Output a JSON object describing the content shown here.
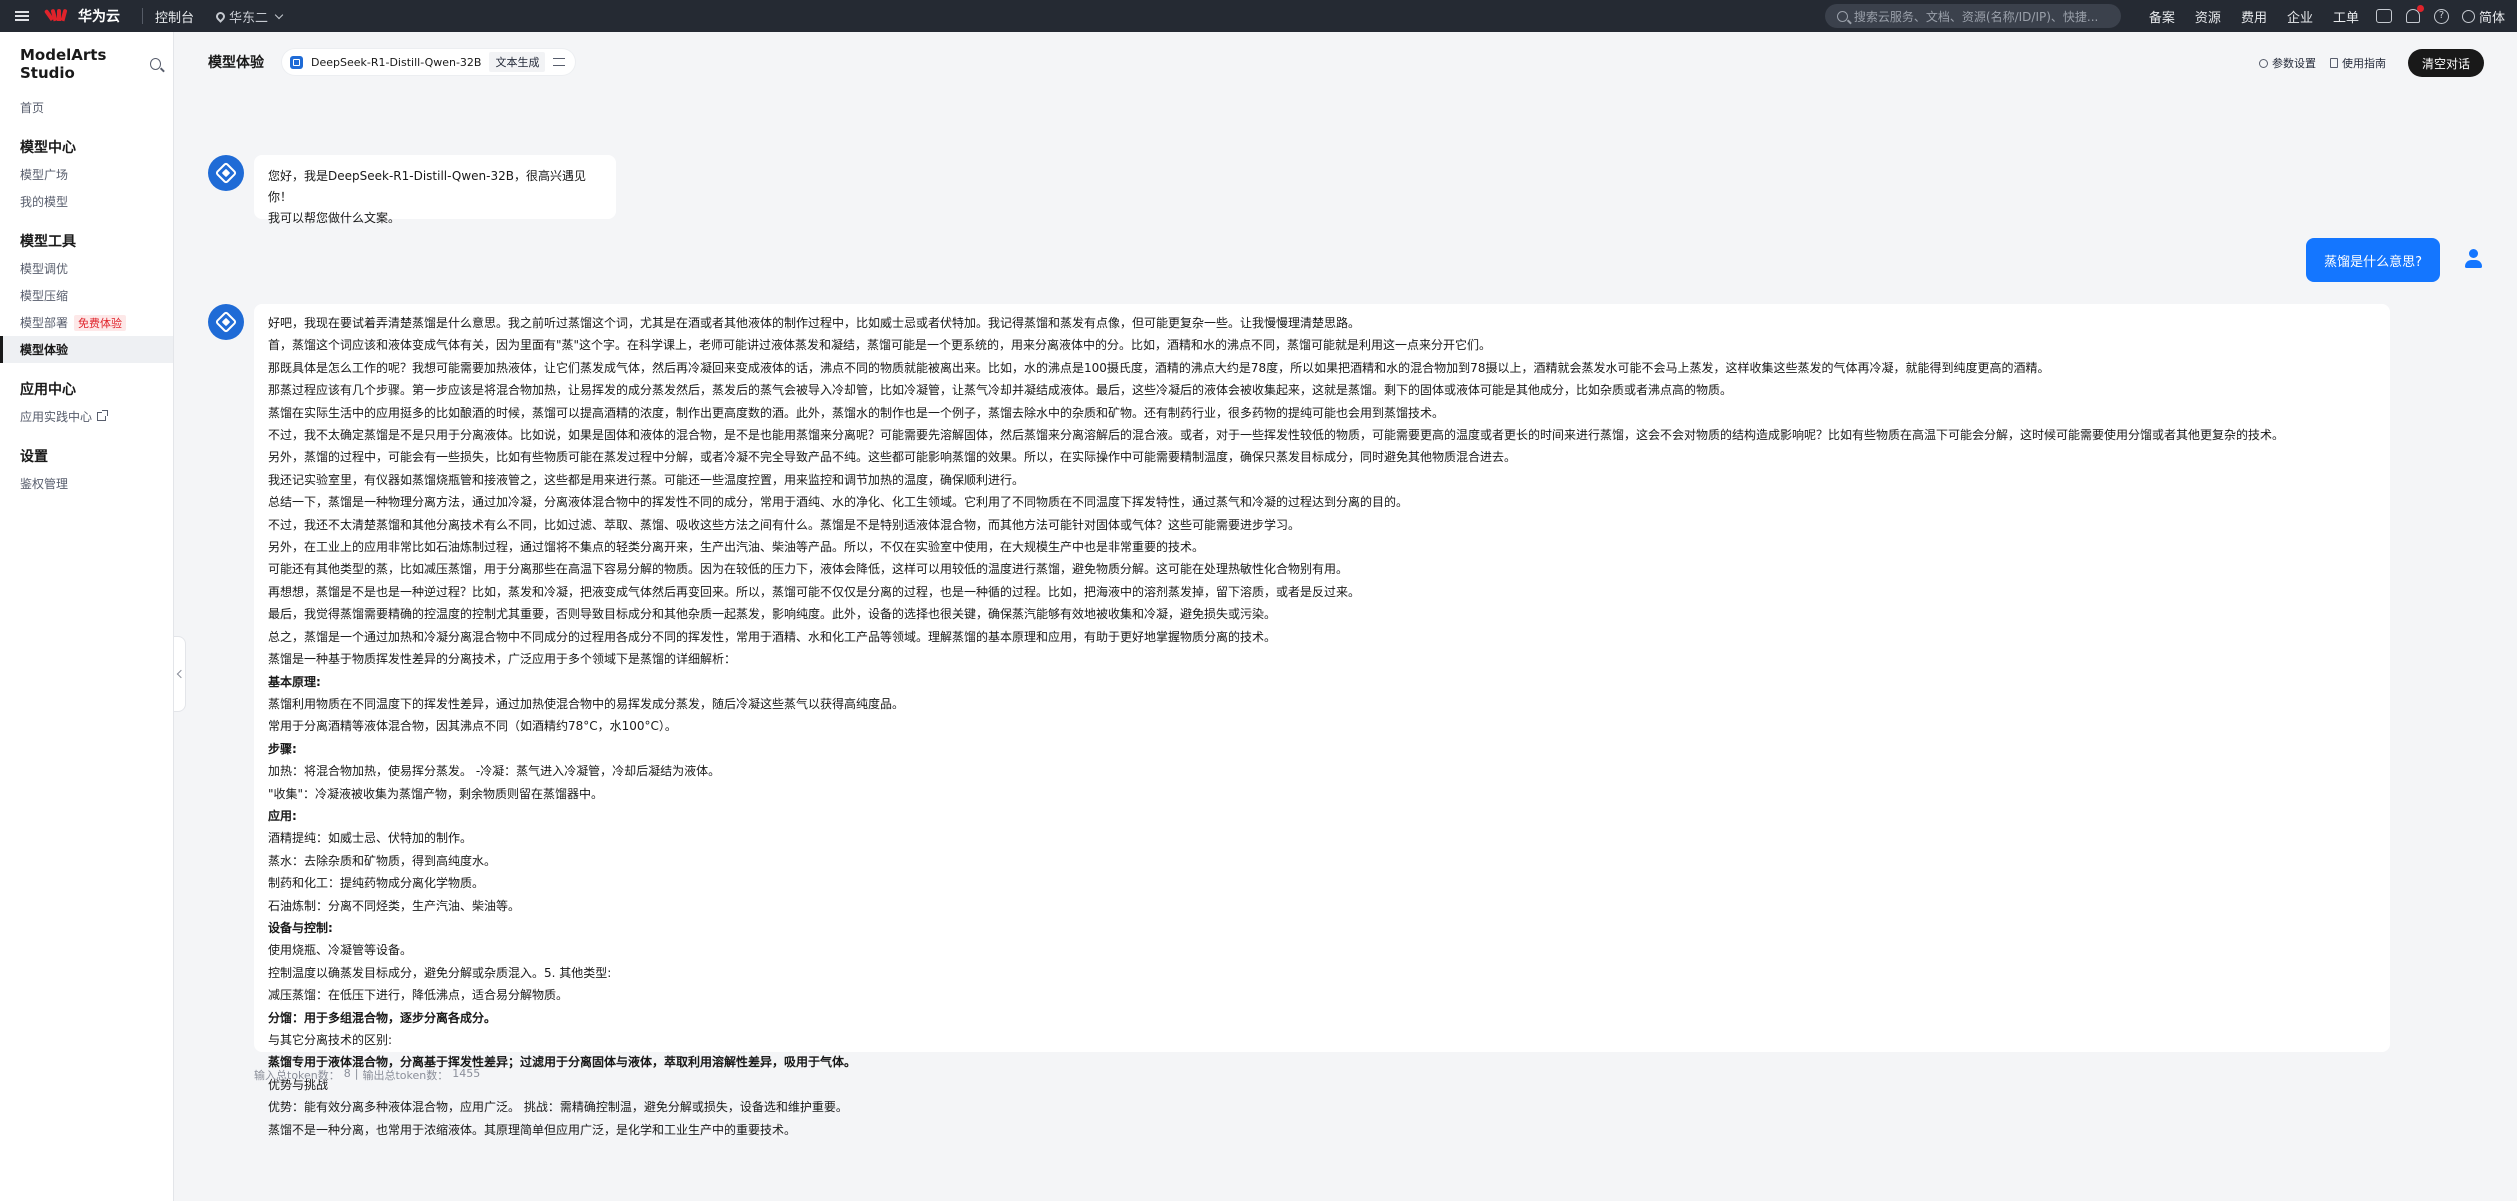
{
  "topbar": {
    "brand": "华为云",
    "console": "控制台",
    "region": "华东二",
    "search_placeholder": "搜索云服务、文档、资源(名称/ID/IP)、快捷...",
    "nav": [
      "备案",
      "资源",
      "费用",
      "企业",
      "工单"
    ],
    "language": "简体"
  },
  "sidebar": {
    "title": "ModelArts Studio",
    "home": "首页",
    "groups": [
      {
        "title": "模型中心",
        "items": [
          "模型广场",
          "我的模型"
        ]
      },
      {
        "title": "模型工具",
        "items": [
          "模型调优",
          "模型压缩",
          "模型部署",
          "模型体验"
        ]
      },
      {
        "title": "应用中心",
        "items": [
          "应用实践中心"
        ]
      },
      {
        "title": "设置",
        "items": [
          "鉴权管理"
        ]
      }
    ],
    "free_badge": "免费体验"
  },
  "header": {
    "title": "模型体验",
    "model": "DeepSeek-R1-Distill-Qwen-32B",
    "task": "文本生成",
    "param_settings": "参数设置",
    "guide": "使用指南",
    "clear": "清空对话"
  },
  "chat": {
    "greeting": [
      "您好，我是DeepSeek-R1-Distill-Qwen-32B，很高兴遇见你！",
      "我可以帮您做什么文案。"
    ],
    "user_message": "蒸馏是什么意思?",
    "answer_lines": [
      "好吧，我现在要试着弄清楚蒸馏是什么意思。我之前听过蒸馏这个词，尤其是在酒或者其他液体的制作过程中，比如威士忌或者伏特加。我记得蒸馏和蒸发有点像，但可能更复杂一些。让我慢慢理清楚思路。",
      "首，蒸馏这个词应该和液体变成气体有关，因为里面有\"蒸\"这个字。在科学课上，老师可能讲过液体蒸发和凝结，蒸馏可能是一个更系统的，用来分离液体中的分。比如，酒精和水的沸点不同，蒸馏可能就是利用这一点来分开它们。",
      "那既具体是怎么工作的呢？我想可能需要加热液体，让它们蒸发成气体，然后再冷凝回来变成液体的话，沸点不同的物质就能被离出来。比如，水的沸点是100摄氏度，酒精的沸点大约是78度，所以如果把酒精和水的混合物加到78摄以上，酒精就会蒸发水可能不会马上蒸发，这样收集这些蒸发的气体再冷凝，就能得到纯度更高的酒精。",
      "那蒸过程应该有几个步骤。第一步应该是将混合物加热，让易挥发的成分蒸发然后，蒸发后的蒸气会被导入冷却管，比如冷凝管，让蒸气冷却并凝结成液体。最后，这些冷凝后的液体会被收集起来，这就是蒸馏。剩下的固体或液体可能是其他成分，比如杂质或者沸点高的物质。",
      "蒸馏在实际生活中的应用挺多的比如酿酒的时候，蒸馏可以提高酒精的浓度，制作出更高度数的酒。此外，蒸馏水的制作也是一个例子，蒸馏去除水中的杂质和矿物。还有制药行业，很多药物的提纯可能也会用到蒸馏技术。",
      "不过，我不太确定蒸馏是不是只用于分离液体。比如说，如果是固体和液体的混合物，是不是也能用蒸馏来分离呢？可能需要先溶解固体，然后蒸馏来分离溶解后的混合液。或者，对于一些挥发性较低的物质，可能需要更高的温度或者更长的时间来进行蒸馏，这会不会对物质的结构造成影响呢？比如有些物质在高温下可能会分解，这时候可能需要使用分馏或者其他更复杂的技术。",
      "另外，蒸馏的过程中，可能会有一些损失，比如有些物质可能在蒸发过程中分解，或者冷凝不完全导致产品不纯。这些都可能影响蒸馏的效果。所以，在实际操作中可能需要精制温度，确保只蒸发目标成分，同时避免其他物质混合进去。",
      "我还记实验室里，有仪器如蒸馏烧瓶管和接液管之，这些都是用来进行蒸。可能还一些温度控置，用来监控和调节加热的温度，确保顺利进行。",
      "总结一下，蒸馏是一种物理分离方法，通过加冷凝，分离液体混合物中的挥发性不同的成分，常用于酒纯、水的净化、化工生领域。它利用了不同物质在不同温度下挥发特性，通过蒸气和冷凝的过程达到分离的目的。",
      "不过，我还不太清楚蒸馏和其他分离技术有么不同，比如过滤、萃取、蒸馏、吸收这些方法之间有什么。蒸馏是不是特别适液体混合物，而其他方法可能针对固体或气体？这些可能需要进步学习。",
      "另外，在工业上的应用非常比如石油炼制过程，通过馏将不集点的轻类分离开来，生产出汽油、柴油等产品。所以，不仅在实验室中使用，在大规模生产中也是非常重要的技术。",
      "可能还有其他类型的蒸，比如减压蒸馏，用于分离那些在高温下容易分解的物质。因为在较低的压力下，液体会降低，这样可以用较低的温度进行蒸馏，避免物质分解。这可能在处理热敏性化合物别有用。",
      "再想想，蒸馏是不是也是一种逆过程？比如，蒸发和冷凝，把液变成气体然后再变回来。所以，蒸馏可能不仅仅是分离的过程，也是一种循的过程。比如，把海液中的溶剂蒸发掉，留下溶质，或者是反过来。",
      "最后，我觉得蒸馏需要精确的控温度的控制尤其重要，否则导致目标成分和其他杂质一起蒸发，影响纯度。此外，设备的选择也很关键，确保蒸汽能够有效地被收集和冷凝，避免损失或污染。",
      "总之，蒸馏是一个通过加热和冷凝分离混合物中不同成分的过程用各成分不同的挥发性，常用于酒精、水和化工产品等领域。理解蒸馏的基本原理和应用，有助于更好地掌握物质分离的技术。",
      "蒸馏是一种基于物质挥发性差异的分离技术，广泛应用于多个领域下是蒸馏的详细解析：",
      "基本原理:",
      "蒸馏利用物质在不同温度下的挥发性差异，通过加热使混合物中的易挥发成分蒸发，随后冷凝这些蒸气以获得高纯度品。",
      "常用于分离酒精等液体混合物，因其沸点不同（如酒精约78°C，水100°C）。",
      "步骤:",
      "加热：将混合物加热，使易挥分蒸发。 -冷凝：蒸气进入冷凝管，冷却后凝结为液体。",
      "\"收集\"：冷凝液被收集为蒸馏产物，剩余物质则留在蒸馏器中。",
      "应用:",
      "酒精提纯：如威士忌、伏特加的制作。",
      "蒸水：去除杂质和矿物质，得到高纯度水。",
      "制药和化工：提纯药物成分离化学物质。",
      "石油炼制：分离不同烃类，生产汽油、柴油等。",
      "设备与控制:",
      "使用烧瓶、冷凝管等设备。",
      "控制温度以确蒸发目标成分，避免分解或杂质混入。5. 其他类型:",
      "减压蒸馏：在低压下进行，降低沸点，适合易分解物质。",
      "分馏：用于多组混合物，逐步分离各成分。",
      "与其它分离技术的区别:",
      "蒸馏专用于液体混合物，分离基于挥发性差异；过滤用于分离固体与液体，萃取利用溶解性差异，吸用于气体。",
      "优势与挑战",
      "优势：能有效分离多种液体混合物，应用广泛。 挑战：需精确控制温，避免分解或损失，设备选和维护重要。",
      "蒸馏不是一种分离，也常用于浓缩液体。其原理简单但应用广泛，是化学和工业生产中的重要技术。"
    ],
    "bold_line_indexes": [
      16,
      19,
      22,
      27,
      31,
      33
    ],
    "tokens_in_label": "输入总token数：",
    "tokens_in": "8",
    "tokens_sep": "|",
    "tokens_out_label": "输出总token数：",
    "tokens_out": "1455"
  },
  "colors": {
    "topbar": "#252a33",
    "accent_blue": "#1476ff",
    "brand_red": "#e0232b",
    "page_bg": "#f4f5f7"
  }
}
